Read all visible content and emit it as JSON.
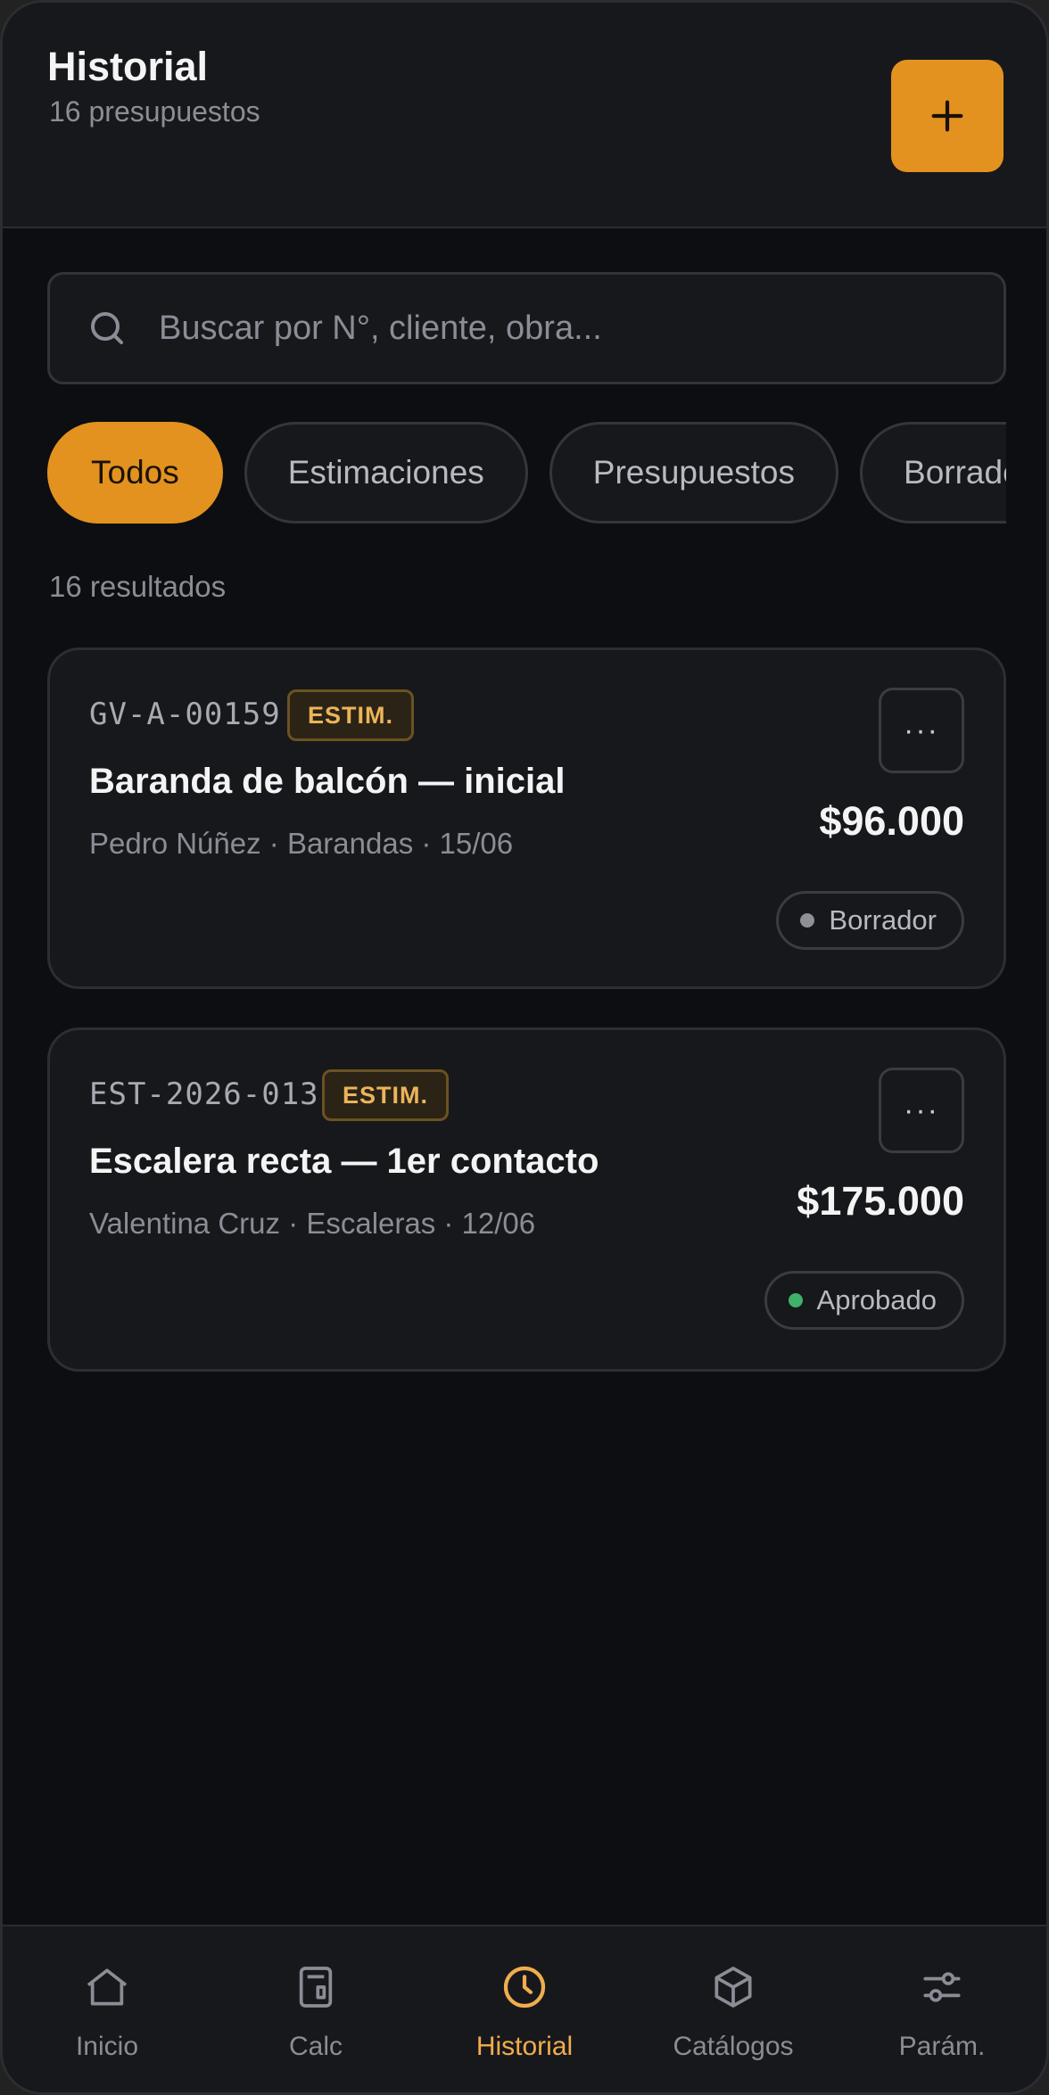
{
  "header": {
    "title": "Historial",
    "subtitle": "16 presupuestos",
    "add_icon": "plus-icon"
  },
  "search": {
    "placeholder": "Buscar por N°, cliente, obra...",
    "value": "",
    "icon": "search-icon"
  },
  "filters": [
    {
      "label": "Todos",
      "active": true
    },
    {
      "label": "Estimaciones",
      "active": false
    },
    {
      "label": "Presupuestos",
      "active": false
    },
    {
      "label": "Borradores",
      "active": false
    }
  ],
  "results_count": "16 resultados",
  "cards": [
    {
      "code": "GV-A-00159",
      "badge": "ESTIM.",
      "name": "Baranda de balcón — inicial",
      "meta": "Pedro Núñez · Barandas · 15/06",
      "amount": "$96.000",
      "status": "Borrador",
      "status_color": "#8e9098",
      "more_label": "···"
    },
    {
      "code": "EST-2026-013",
      "badge": "ESTIM.",
      "name": "Escalera recta — 1er contacto",
      "meta": "Valentina Cruz · Escaleras · 12/06",
      "amount": "$175.000",
      "status": "Aprobado",
      "status_color": "#3fb26a",
      "more_label": "···"
    }
  ],
  "tabbar": [
    {
      "label": "Inicio",
      "icon": "home-icon",
      "active": false
    },
    {
      "label": "Calc",
      "icon": "calculator-icon",
      "active": false
    },
    {
      "label": "Historial",
      "icon": "clock-icon",
      "active": true
    },
    {
      "label": "Catálogos",
      "icon": "box-icon",
      "active": false
    },
    {
      "label": "Parám.",
      "icon": "sliders-icon",
      "active": false
    }
  ],
  "colors": {
    "accent": "#e39220",
    "background": "#0d0e11",
    "surface": "#17181c"
  }
}
